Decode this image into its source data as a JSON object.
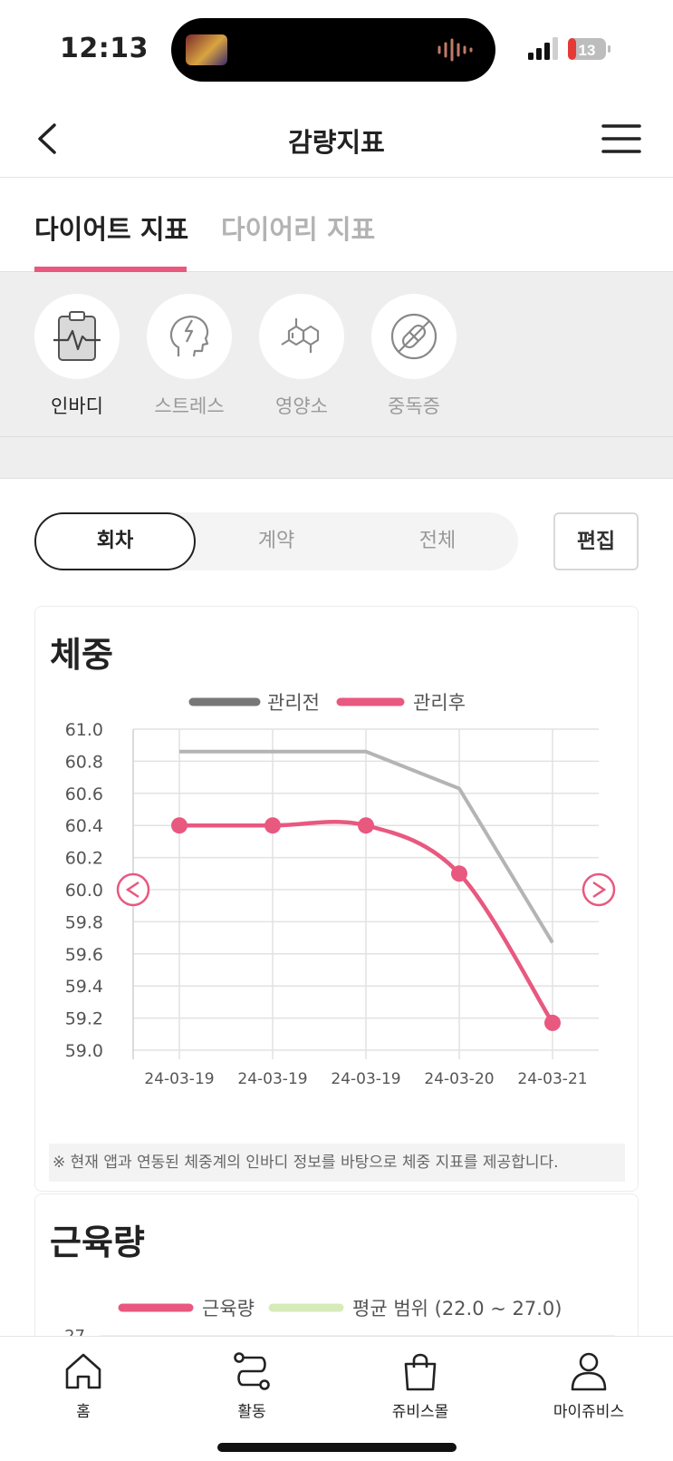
{
  "status_bar": {
    "time": "12:13",
    "battery": "13"
  },
  "header": {
    "title": "감량지표"
  },
  "main_tabs": [
    {
      "label": "다이어트 지표",
      "active": true
    },
    {
      "label": "다이어리 지표",
      "active": false
    }
  ],
  "categories": [
    {
      "label": "인바디",
      "icon": "clipboard-heartbeat-icon",
      "active": true
    },
    {
      "label": "스트레스",
      "icon": "stress-head-icon",
      "active": false
    },
    {
      "label": "영양소",
      "icon": "molecule-icon",
      "active": false
    },
    {
      "label": "중독증",
      "icon": "no-pill-icon",
      "active": false
    }
  ],
  "segment": {
    "options": [
      "회차",
      "계약",
      "전체"
    ],
    "selected": "회차",
    "edit_label": "편집"
  },
  "colors": {
    "accent": "#e8587f",
    "before_line": "#b4b4b4",
    "range_band": "#d6ebb8",
    "grid": "#e2e2e2"
  },
  "weight_card": {
    "title": "체중",
    "note": "※ 현재 앱과 연동된 체중계의 인바디 정보를 바탕으로 체중 지표를 제공합니다."
  },
  "muscle_card": {
    "title": "근육량",
    "legend": [
      "근육량",
      "평균 범위 (22.0 ~ 27.0)"
    ],
    "first_tick": "27"
  },
  "chart_data": [
    {
      "type": "line",
      "title": "체중",
      "categories": [
        "24-03-19",
        "24-03-19",
        "24-03-19",
        "24-03-20",
        "24-03-21"
      ],
      "series": [
        {
          "name": "관리전",
          "values": [
            60.86,
            60.86,
            60.86,
            60.63,
            59.67
          ]
        },
        {
          "name": "관리후",
          "values": [
            60.4,
            60.4,
            60.4,
            60.1,
            59.17
          ]
        }
      ],
      "ylim": [
        59.0,
        61.0
      ],
      "yticks": [
        "61.0",
        "60.8",
        "60.6",
        "60.4",
        "60.2",
        "60.0",
        "59.8",
        "59.6",
        "59.4",
        "59.2",
        "59.0"
      ],
      "grid": true,
      "legend_position": "top-center"
    },
    {
      "type": "line",
      "title": "근육량",
      "series": [
        {
          "name": "근육량",
          "values": []
        },
        {
          "name": "평균 범위 (22.0 ~ 27.0)",
          "values": []
        }
      ],
      "yticks": [
        "27"
      ]
    }
  ],
  "bottom_nav": [
    {
      "label": "홈",
      "icon": "home-icon"
    },
    {
      "label": "활동",
      "icon": "route-icon"
    },
    {
      "label": "쥬비스몰",
      "icon": "shopping-bag-icon"
    },
    {
      "label": "마이쥬비스",
      "icon": "person-icon"
    }
  ]
}
